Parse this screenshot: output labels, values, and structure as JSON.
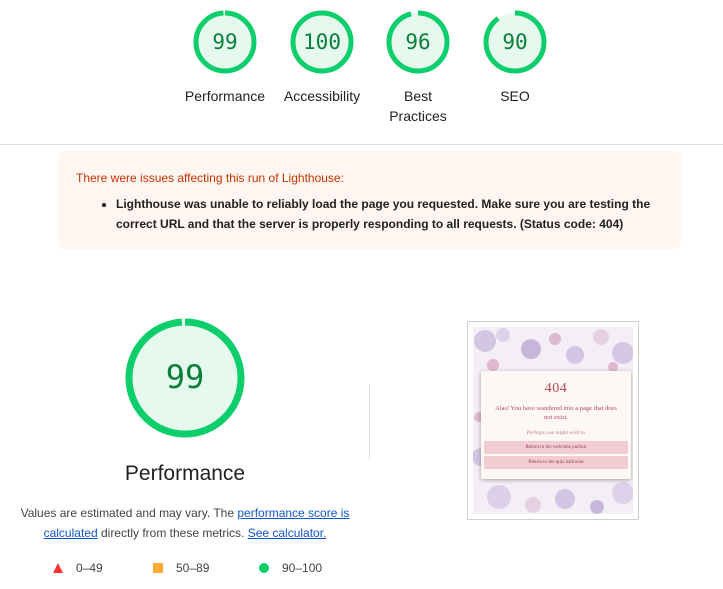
{
  "categories": [
    {
      "score": "99",
      "label": "Performance",
      "fraction": 0.99,
      "color": "#0cce6b"
    },
    {
      "score": "100",
      "label": "Accessibility",
      "fraction": 1.0,
      "color": "#0cce6b"
    },
    {
      "score": "96",
      "label": "Best Practices",
      "fraction": 0.96,
      "color": "#0cce6b"
    },
    {
      "score": "90",
      "label": "SEO",
      "fraction": 0.9,
      "color": "#0cce6b"
    }
  ],
  "warning": {
    "title": "There were issues affecting this run of Lighthouse:",
    "items": [
      "Lighthouse was unable to reliably load the page you requested. Make sure you are testing the correct URL and that the server is properly responding to all requests. (Status code: 404)"
    ]
  },
  "performance": {
    "score": "99",
    "fraction": 0.99,
    "title": "Performance",
    "desc_prefix": "Values are estimated and may vary. The ",
    "desc_link1": "performance score is calculated",
    "desc_middle": " directly from these metrics. ",
    "desc_link2": "See calculator."
  },
  "legend": [
    {
      "shape": "triangle",
      "color": "#ff3333",
      "range": "0–49"
    },
    {
      "shape": "square",
      "color": "#ffaa33",
      "range": "50–89"
    },
    {
      "shape": "circle",
      "color": "#0cce6b",
      "range": "90–100"
    }
  ],
  "screenshot": {
    "code": "404",
    "message": "Alas! You have wandered into a page that does not exist.",
    "subtitle": "Perhaps you might wish to",
    "button1": "Return to the welcome parlour",
    "button2": "Return to the quiz ballroom"
  },
  "colors": {
    "pass": "#0cce6b",
    "pass_bg": "#e5f9ee",
    "pass_text": "#0a7f3a"
  }
}
